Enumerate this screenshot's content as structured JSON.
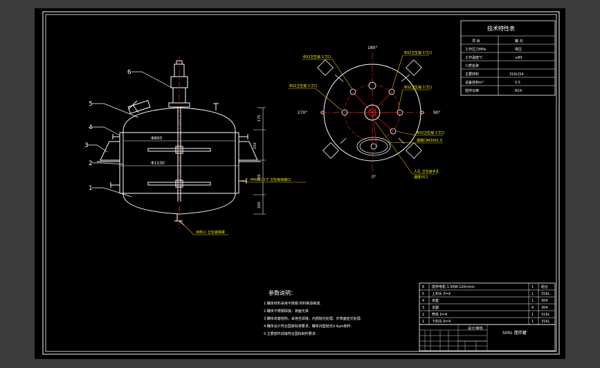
{
  "colors": {
    "background": "#3c3c3c",
    "drawing_area": "#000000",
    "line": "#ffffff",
    "centerline": "#ff2020",
    "dimension": "#ffffff",
    "label": "#ffff00",
    "leader": "#e6c800",
    "header_panel": "#141414"
  },
  "drawing": {
    "title_500l": "500L  搅拌罐",
    "spec_table": {
      "title": "技术特性表",
      "rows": [
        [
          "项  目",
          "罐  内"
        ],
        [
          "工作压力MPa",
          "常压"
        ],
        [
          "工作温度℃",
          "≤80"
        ],
        [
          "介质名称",
          ""
        ],
        [
          "主要材料",
          "316L(S4"
        ],
        [
          "设备容积m³",
          "0.5"
        ],
        [
          "搅拌功率",
          "Φ16"
        ]
      ]
    },
    "notes": {
      "title": "参数说明：",
      "lines": [
        "1.罐体材料采用不锈钢 材料制造制成.",
        "2.罐体不锈钢焊接，液面光滑.",
        "3.罐体夹套结构，采用全焊接，内部抛光处理，外表面亚光处理.",
        "4.罐体设计符合国家标准要求，罐体内壁抛光0.4μm制作.",
        "5.主要部件焊接符合国标制作要求."
      ]
    },
    "parts_list": [
      {
        "no": "6",
        "name": "搅拌电机 1.5KW-120r/min",
        "qty": "1",
        "mat": "组合"
      },
      {
        "no": "5",
        "name": "上封头 δ=4",
        "qty": "1",
        "mat": "316L"
      },
      {
        "no": "4",
        "name": "夹套",
        "qty": "1",
        "mat": "304"
      },
      {
        "no": "3",
        "name": "支腿",
        "qty": "4",
        "mat": "304"
      },
      {
        "no": "2",
        "name": "筒体 δ=4",
        "qty": "1",
        "mat": "316L"
      },
      {
        "no": "1",
        "name": "下封头 δ=4",
        "qty": "1",
        "mat": "316L"
      }
    ],
    "title_block_label": "设计/审核",
    "part_labels": [
      "1",
      "2",
      "3",
      "4",
      "5",
      "6"
    ],
    "dims_main": [
      "Φ800",
      "Φ1100"
    ],
    "dims_vertical": [
      "175",
      "250",
      "400",
      "200"
    ],
    "side_annotations": [
      "PH计口 1寸 卫生级快装口",
      "出料口 卫生级球阀"
    ],
    "angles": [
      "180°",
      "270°",
      "90°",
      "0°"
    ],
    "plan_annotations": [
      "Φ32卫生级 1寸口",
      "Φ32卫生级 1寸口",
      "Φ32卫生级 1寸口",
      "Φ32卫生级 1寸口",
      "Φ32卫生级 1寸口",
      "视镜口M20X1.5",
      "人孔 卫生级手孔",
      "温度计口"
    ]
  }
}
